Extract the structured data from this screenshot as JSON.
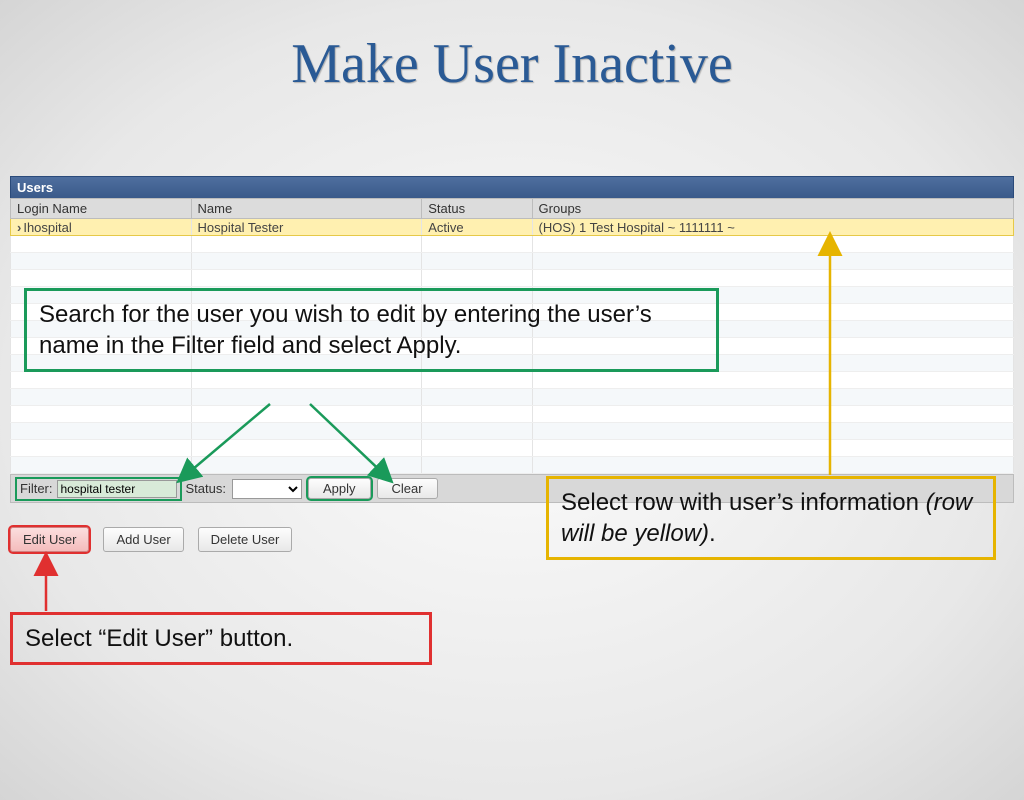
{
  "title": "Make User Inactive",
  "panel": {
    "header": "Users",
    "columns": [
      "Login Name",
      "Name",
      "Status",
      "Groups"
    ],
    "row": {
      "login": "Ihospital",
      "name": "Hospital Tester",
      "status": "Active",
      "groups": "(HOS) 1 Test Hospital ~ 1111111 ~"
    }
  },
  "filter": {
    "label": "Filter:",
    "value": "hospital tester",
    "status_label": "Status:",
    "status_value": "",
    "apply": "Apply",
    "clear": "Clear"
  },
  "buttons": {
    "edit": "Edit User",
    "add": "Add User",
    "del": "Delete User"
  },
  "callouts": {
    "search": "Search for the user you wish to edit by entering the user’s name in the Filter field and select Apply.",
    "select_a": "Select row with user’s information ",
    "select_b": "(row will be yellow)",
    "select_c": ".",
    "edit": "Select “Edit User” button."
  }
}
